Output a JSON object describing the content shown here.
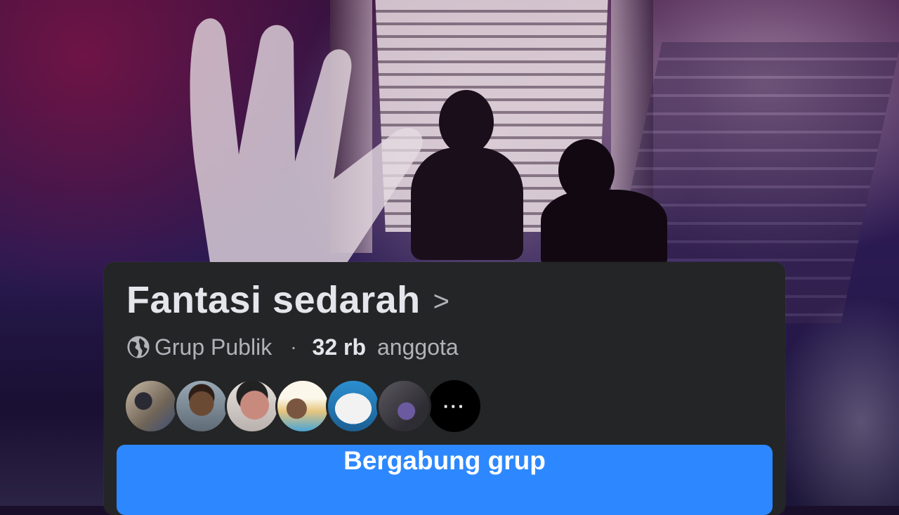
{
  "group": {
    "name": "Fantasi sedarah",
    "chevron": ">",
    "privacy": "Grup Publik",
    "separator": "·",
    "member_count": "32 rb",
    "member_label": "anggota",
    "more_members": "···",
    "join_label": "Bergabung grup"
  },
  "colors": {
    "card_background": "#242526",
    "primary_text": "#e4e6eb",
    "secondary_text": "#b0b3b8",
    "button_blue": "#2d88ff"
  },
  "icons": {
    "privacy": "globe-icon",
    "more": "more-dots-icon"
  }
}
